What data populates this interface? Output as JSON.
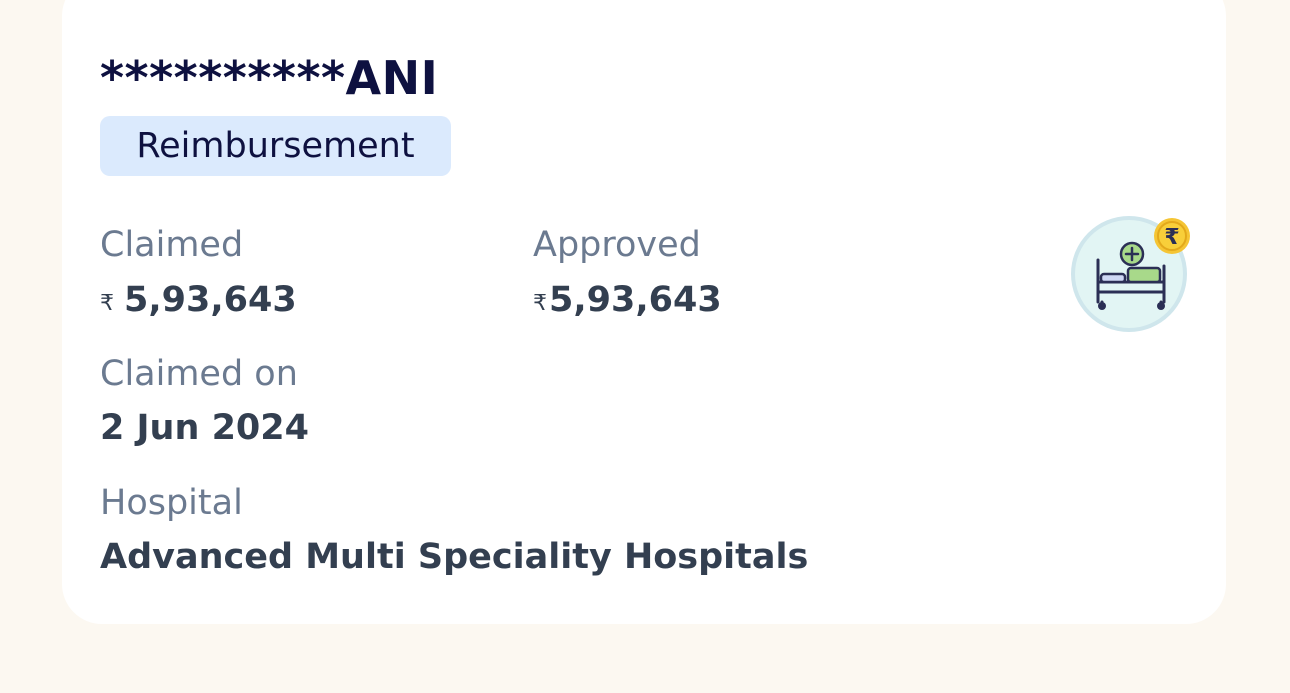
{
  "claim": {
    "member_name": "**********ANI",
    "type_badge": "Reimbursement",
    "claimed_label": "Claimed",
    "claimed_currency": "₹",
    "claimed_amount": "5,93,643",
    "approved_label": "Approved",
    "approved_currency": "₹",
    "approved_amount": "5,93,643",
    "claimed_on_label": "Claimed on",
    "claimed_on_value": "2 Jun 2024",
    "hospital_label": "Hospital",
    "hospital_value": "Advanced Multi Speciality Hospitals",
    "illustration_icon": "hospital-bed-rupee-icon"
  },
  "colors": {
    "background": "#fcf8f1",
    "card": "#ffffff",
    "title": "#0e1140",
    "badge_bg": "#dbeafd",
    "label": "#6b7a90",
    "value": "#333f50",
    "coin": "#f5c534"
  }
}
